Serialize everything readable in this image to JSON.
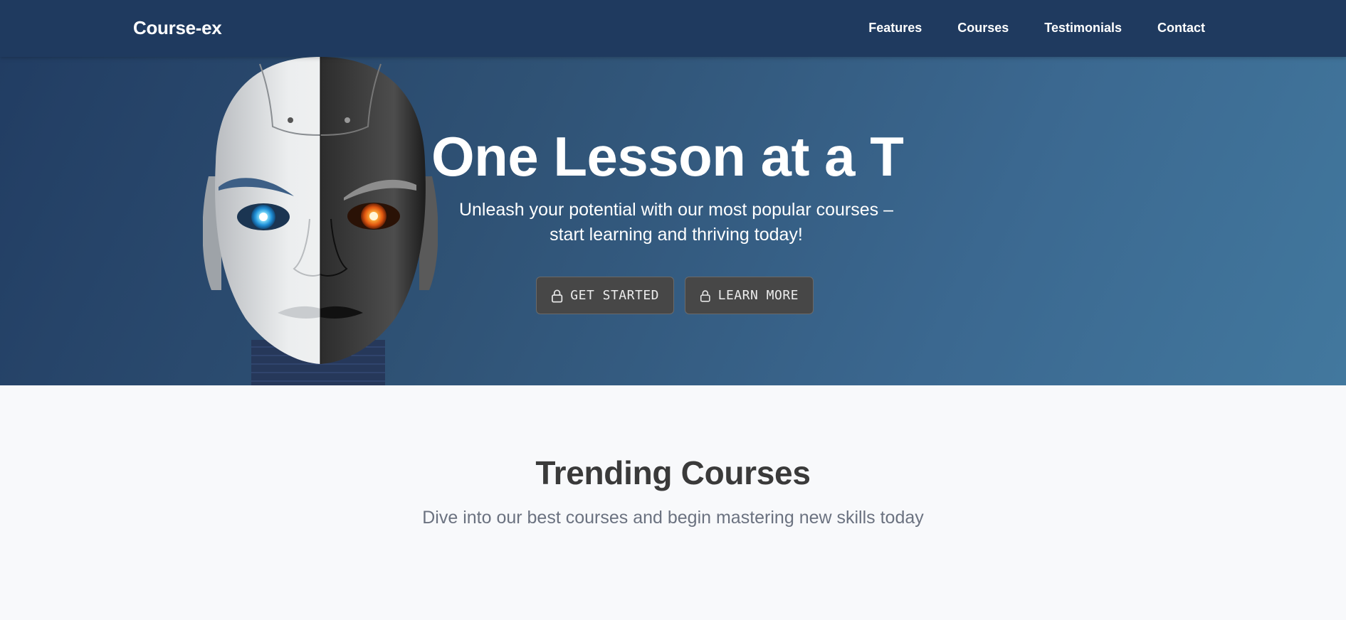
{
  "header": {
    "logo": "Course-ex",
    "nav": [
      {
        "label": "Features"
      },
      {
        "label": "Courses"
      },
      {
        "label": "Testimonials"
      },
      {
        "label": "Contact"
      }
    ]
  },
  "hero": {
    "title": "One Lesson at a T",
    "subtitle": "Unleash your potential with our most popular courses – start learning and thriving today!",
    "buttons": [
      {
        "label": "GET STARTED",
        "icon": "lock-icon"
      },
      {
        "label": "LEARN MORE",
        "icon": "lock-icon"
      }
    ],
    "image": "robot-face-image"
  },
  "trending": {
    "title": "Trending Courses",
    "subtitle": "Dive into our best courses and begin mastering new skills today"
  },
  "colors": {
    "header_bg": "#1f3a5f",
    "hero_gradient_start": "#213c62",
    "hero_gradient_end": "#42789e",
    "button_bg": "#474747",
    "section_bg": "#f8f9fb",
    "title_dark": "#3a3a3a",
    "subtitle_gray": "#6b7280"
  }
}
